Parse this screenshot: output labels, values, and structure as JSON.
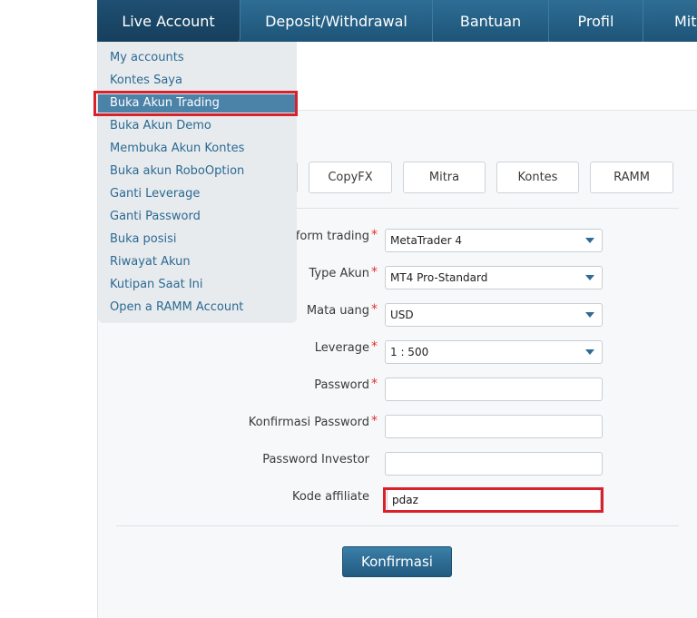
{
  "topnav": {
    "tabs": [
      {
        "label": "Live Account"
      },
      {
        "label": "Deposit/Withdrawal"
      },
      {
        "label": "Bantuan"
      },
      {
        "label": "Profil"
      },
      {
        "label": "Mit"
      }
    ]
  },
  "dropdown": {
    "items": [
      {
        "label": "My accounts"
      },
      {
        "label": "Kontes Saya"
      },
      {
        "label": "Buka Akun Trading"
      },
      {
        "label": "Buka Akun Demo"
      },
      {
        "label": "Membuka Akun Kontes"
      },
      {
        "label": "Buka akun RoboOption"
      },
      {
        "label": "Ganti Leverage"
      },
      {
        "label": "Ganti Password"
      },
      {
        "label": "Buka posisi"
      },
      {
        "label": "Riwayat Akun"
      },
      {
        "label": "Kutipan Saat Ini"
      },
      {
        "label": "Open a RAMM Account"
      }
    ],
    "selected": "Buka Akun Trading"
  },
  "account_tabs": [
    {
      "label": "CopyFX"
    },
    {
      "label": "Mitra"
    },
    {
      "label": "Kontes"
    },
    {
      "label": "RAMM"
    }
  ],
  "form": {
    "platform_label": "atform trading",
    "platform_value": "MetaTrader 4",
    "type_label": "Type Akun",
    "type_value": "MT4 Pro-Standard",
    "currency_label": "Mata uang",
    "currency_value": "USD",
    "leverage_label": "Leverage",
    "leverage_value": "1 : 500",
    "password_label": "Password",
    "password_value": "",
    "confirm_password_label": "Konfirmasi Password",
    "confirm_password_value": "",
    "investor_password_label": "Password Investor",
    "investor_password_value": "",
    "affiliate_label": "Kode affiliate",
    "affiliate_value": "pdaz",
    "required_mark": "*",
    "submit_label": "Konfirmasi"
  },
  "colors": {
    "nav": "#2f6d95",
    "nav_active": "#1f4f72",
    "link": "#2b6a93",
    "selected_bg": "#4a82a8",
    "highlight": "#d9202b",
    "required": "#e0312e"
  }
}
